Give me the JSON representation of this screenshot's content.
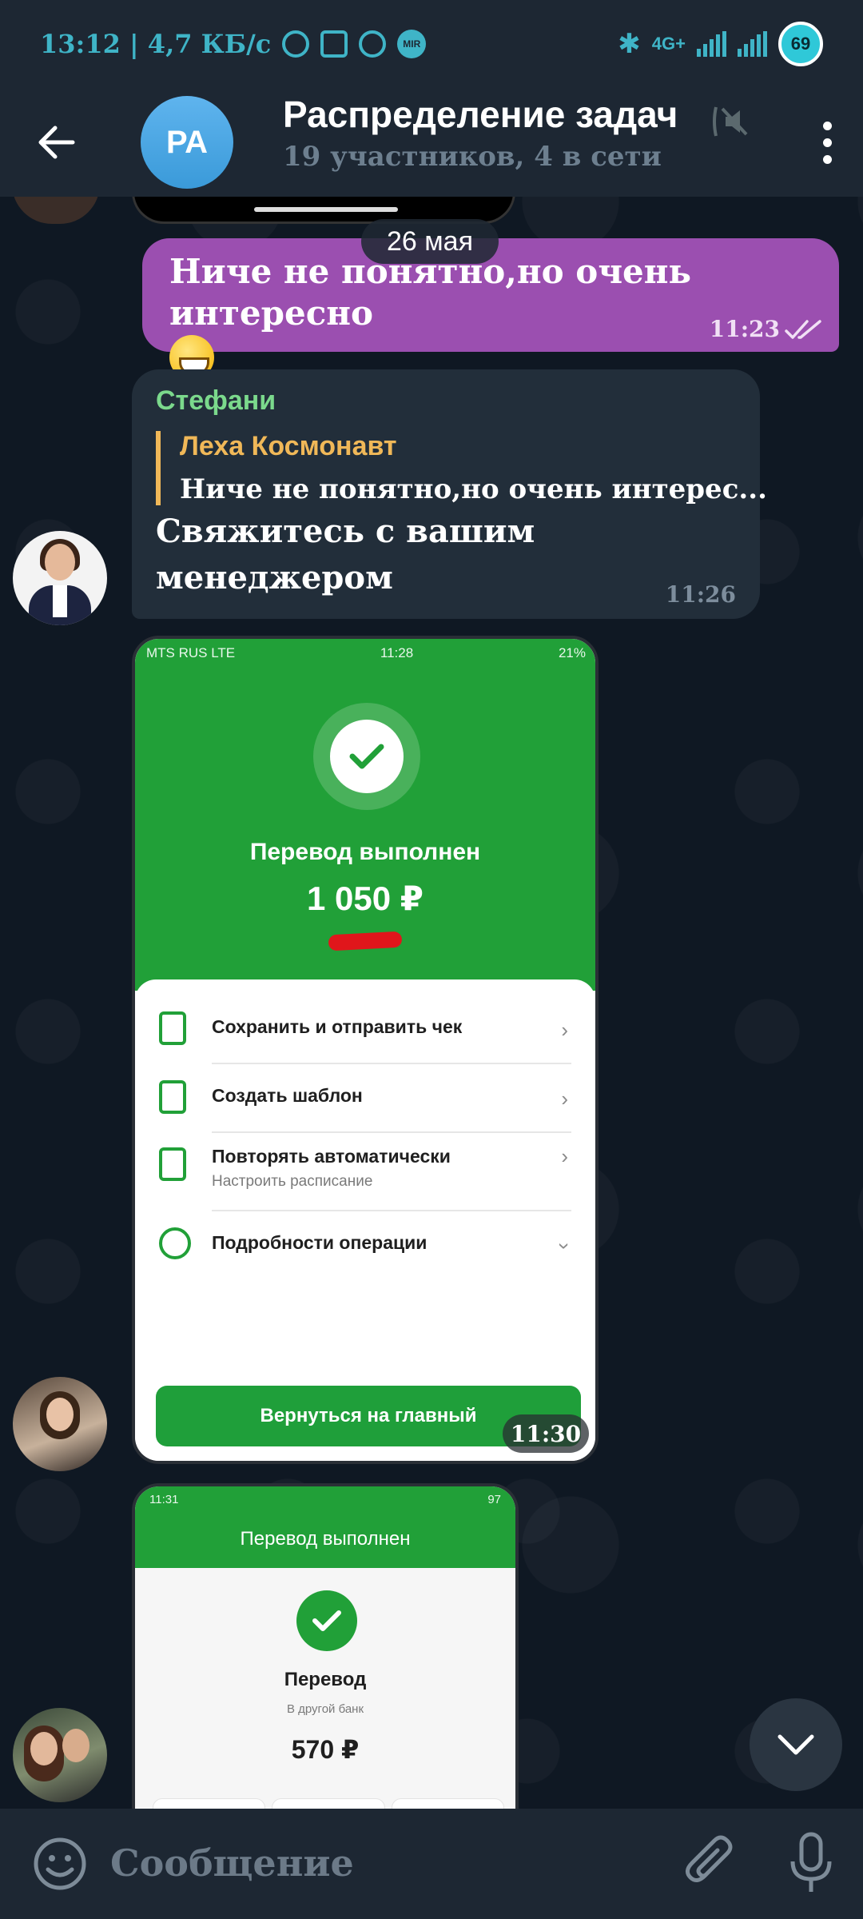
{
  "status_bar": {
    "time_speed": "13:12 | 4,7 КБ/с",
    "network": "4G+",
    "battery": "69"
  },
  "header": {
    "avatar_initials": "РА",
    "title": "Распределение задач",
    "subtitle": "19 участников, 4 в сети"
  },
  "date_chip": "26 мая",
  "messages": [
    {
      "type": "outgoing",
      "text": "Ниче не понятно,но очень интересно",
      "time": "11:23"
    },
    {
      "type": "incoming",
      "sender": "Стефани",
      "reply_name": "Леха Космонавт",
      "reply_text": "Ниче не понятно,но очень интерес...",
      "text_line1": "Свяжитесь с вашим",
      "text_line2": "менеджером",
      "time": "11:26"
    }
  ],
  "shot1": {
    "status_left": "MTS RUS  LTE",
    "status_center": "11:28",
    "status_right": "21%",
    "title": "Перевод выполнен",
    "amount": "1 050 ₽",
    "rows": [
      {
        "label": "Сохранить и отправить чек",
        "sub": ""
      },
      {
        "label": "Создать шаблон",
        "sub": ""
      },
      {
        "label": "Повторять автоматически",
        "sub": "Настроить расписание"
      },
      {
        "label": "Подробности операции",
        "sub": ""
      }
    ],
    "button": "Вернуться на главный",
    "time": "11:30"
  },
  "shot2": {
    "status_left": "11:31",
    "status_right": "97",
    "title": "Перевод выполнен",
    "label": "Перевод",
    "sub": "В другой банк",
    "amount": "570 ₽"
  },
  "input": {
    "placeholder": "Сообщение"
  },
  "colors": {
    "header_bg": "#1d2733",
    "outgoing_bubble": "#9b4fb0",
    "incoming_bubble": "#222e3a",
    "sender_name": "#7bd98c",
    "reply_accent": "#f0b858",
    "bank_green": "#21a038"
  }
}
